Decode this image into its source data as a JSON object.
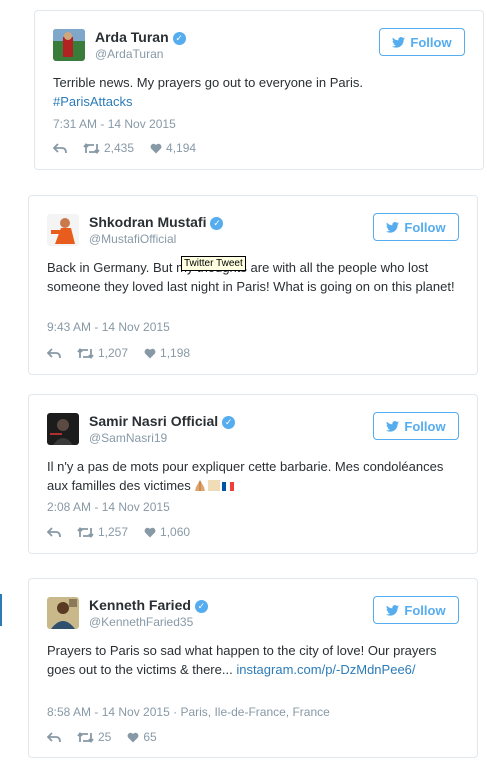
{
  "tweets": [
    {
      "name": "Arda Turan",
      "handle": "@ArdaTuran",
      "follow_label": "Follow",
      "text": "Terrible news. My prayers go out to everyone in Paris.",
      "hashtag": "#ParisAttacks",
      "time": "7:31 AM - 14 Nov 2015",
      "retweets": "2,435",
      "likes": "4,194"
    },
    {
      "name": "Shkodran Mustafi",
      "handle": "@MustafiOfficial",
      "follow_label": "Follow",
      "text": "Back in Germany. But my thoughts are with all the people who lost someone they loved last night in Paris! What is going on on this planet!",
      "time": "9:43 AM - 14 Nov 2015",
      "retweets": "1,207",
      "likes": "1,198"
    },
    {
      "name": "Samir Nasri Official",
      "handle": "@SamNasri19",
      "follow_label": "Follow",
      "text": "Il n'y a pas de mots pour expliquer cette barbarie. Mes condoléances aux familles des victimes",
      "time": "2:08 AM - 14 Nov 2015",
      "retweets": "1,257",
      "likes": "1,060"
    },
    {
      "name": "Kenneth Faried",
      "handle": "@KennethFaried35",
      "follow_label": "Follow",
      "text": "Prayers to Paris so sad what happen to the city of love! Our prayers goes out to the victims & there...",
      "link": "instagram.com/p/-DzMdnPee6/",
      "time": "8:58 AM - 14 Nov 2015",
      "location": "Paris, Ile-de-France, France",
      "retweets": "25",
      "likes": "65"
    }
  ],
  "tooltip": "Twitter Tweet",
  "colors": {
    "twitter_blue": "#55acee",
    "link": "#2b7bb9",
    "meta_gray": "#8899a6"
  }
}
